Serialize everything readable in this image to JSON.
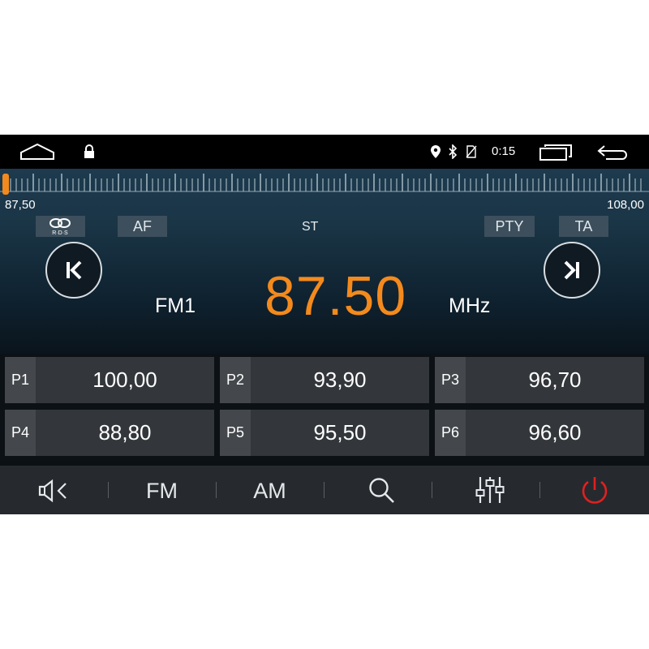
{
  "status_bar": {
    "time": "0:15",
    "icons": [
      "home-icon",
      "lock-icon",
      "location-icon",
      "bluetooth-icon",
      "no-sim-icon",
      "recents-icon",
      "back-icon"
    ]
  },
  "tuner": {
    "range_min": "87,50",
    "range_max": "108,00",
    "needle_fraction": 0.0,
    "flags": {
      "rds": "R·D·S",
      "af": "AF",
      "st": "ST",
      "pty": "PTY",
      "ta": "TA"
    },
    "band": "FM1",
    "frequency": "87.50",
    "unit": "MHz"
  },
  "presets": [
    {
      "label": "P1",
      "freq": "100,00"
    },
    {
      "label": "P2",
      "freq": "93,90"
    },
    {
      "label": "P3",
      "freq": "96,70"
    },
    {
      "label": "P4",
      "freq": "88,80"
    },
    {
      "label": "P5",
      "freq": "95,50"
    },
    {
      "label": "P6",
      "freq": "96,60"
    }
  ],
  "bottom_bar": {
    "fm": "FM",
    "am": "AM",
    "icons": [
      "mute-icon",
      "search-icon",
      "equalizer-icon",
      "power-icon"
    ]
  },
  "colors": {
    "accent": "#f48a1c",
    "power": "#e02020"
  }
}
